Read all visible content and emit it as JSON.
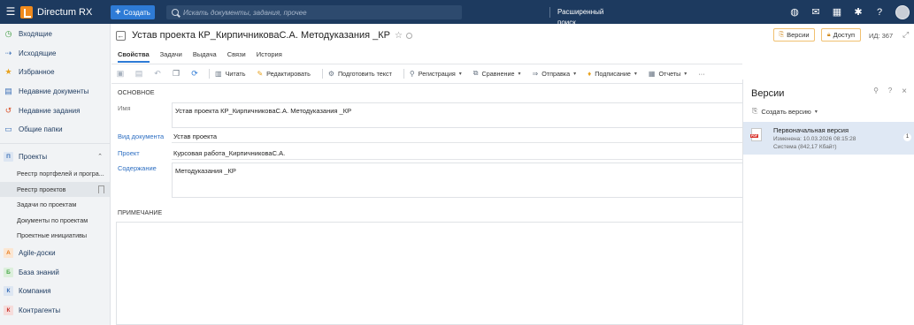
{
  "app": {
    "name": "Directum RX",
    "menu_icon": "hamburger-icon"
  },
  "topbar": {
    "create_label": "Создать",
    "search_placeholder": "Искать документы, задания, прочее",
    "advanced_search": "Расширенный поиск",
    "icons": [
      "globe-icon",
      "mail-icon",
      "calendar-icon",
      "settings-icon",
      "help-icon",
      "avatar"
    ]
  },
  "sidebar": {
    "main_items": [
      {
        "label": "Входящие",
        "icon": "clock-icon"
      },
      {
        "label": "Исходящие",
        "icon": "outbox-icon"
      },
      {
        "label": "Избранное",
        "icon": "star-icon"
      },
      {
        "label": "Недавние документы",
        "icon": "document-icon"
      },
      {
        "label": "Недавние задания",
        "icon": "history-icon"
      },
      {
        "label": "Общие папки",
        "icon": "folder-icon"
      }
    ],
    "projects": {
      "letter": "П",
      "label": "Проекты",
      "sub_items": [
        {
          "label": "Реестр портфелей и програ..."
        },
        {
          "label": "Реестр проектов"
        },
        {
          "label": "Задачи по проектам"
        },
        {
          "label": "Документы по проектам"
        },
        {
          "label": "Проектные инициативы"
        }
      ]
    },
    "modules": [
      {
        "letter": "A",
        "label": "Agile-доски",
        "color": "#e87d1e"
      },
      {
        "letter": "Б",
        "label": "База знаний",
        "color": "#4aa84a"
      },
      {
        "letter": "К",
        "label": "Компания",
        "color": "#3a6fb7"
      },
      {
        "letter": "К",
        "label": "Контрагенты",
        "color": "#c7342d"
      }
    ]
  },
  "document": {
    "title": "Устав проекта КР_КирпичниковаС.А. Методуказания _КР",
    "tabs": [
      "Свойства",
      "Задачи",
      "Выдача",
      "Связи",
      "История"
    ],
    "active_tab": "Свойства",
    "toolbar": {
      "read": "Читать",
      "edit": "Редактировать",
      "prepare_text": "Подготовить текст",
      "registration": "Регистрация",
      "compare": "Сравнение",
      "send": "Отправка",
      "sign": "Подписание",
      "reports": "Отчеты",
      "more": "···"
    },
    "section_main": "ОСНОВНОЕ",
    "fields": {
      "name_label": "Имя",
      "name_value": "Устав проекта КР_КирпичниковаС.А. Методуказания _КР",
      "doctype_label": "Вид документа",
      "doctype_value": "Устав проекта",
      "project_label": "Проект",
      "project_value": "Курсовая работа_КирпичниковаС.А.",
      "content_label": "Содержание",
      "content_value": "Методуказания _КР"
    },
    "section_note": "ПРИМЕЧАНИЕ",
    "versions_btn": "Версии",
    "access_btn": "Доступ",
    "id_text": "ИД: 367"
  },
  "versions_panel": {
    "title": "Версии",
    "create_version": "Создать версию",
    "items": [
      {
        "name": "Первоначальная версия",
        "modified": "Изменена: 10.03.2026 08:15:28",
        "meta": "Система (842,17 Кбайт)",
        "number": "1",
        "icon": "pdf-icon"
      }
    ]
  },
  "colors": {
    "topbar": "#1d3a5f",
    "accent": "#2e7bd6",
    "selected_version": "#dfe8f4"
  }
}
